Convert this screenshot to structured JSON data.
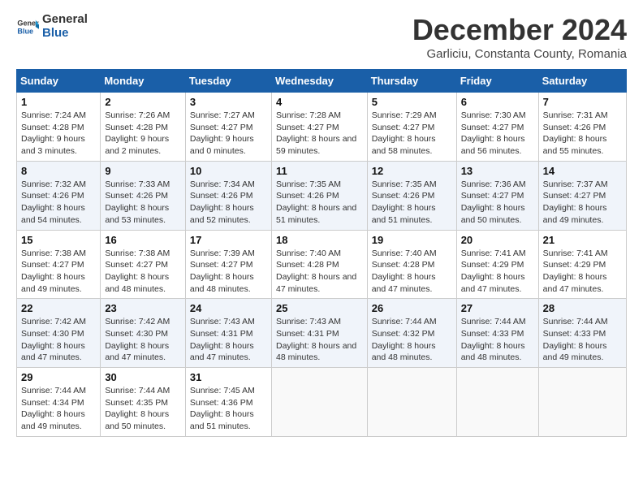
{
  "header": {
    "logo_line1": "General",
    "logo_line2": "Blue",
    "month_title": "December 2024",
    "subtitle": "Garliciu, Constanta County, Romania"
  },
  "days_of_week": [
    "Sunday",
    "Monday",
    "Tuesday",
    "Wednesday",
    "Thursday",
    "Friday",
    "Saturday"
  ],
  "weeks": [
    [
      {
        "num": "1",
        "rise": "7:24 AM",
        "set": "4:28 PM",
        "daylight": "9 hours and 3 minutes."
      },
      {
        "num": "2",
        "rise": "7:26 AM",
        "set": "4:28 PM",
        "daylight": "9 hours and 2 minutes."
      },
      {
        "num": "3",
        "rise": "7:27 AM",
        "set": "4:27 PM",
        "daylight": "9 hours and 0 minutes."
      },
      {
        "num": "4",
        "rise": "7:28 AM",
        "set": "4:27 PM",
        "daylight": "8 hours and 59 minutes."
      },
      {
        "num": "5",
        "rise": "7:29 AM",
        "set": "4:27 PM",
        "daylight": "8 hours and 58 minutes."
      },
      {
        "num": "6",
        "rise": "7:30 AM",
        "set": "4:27 PM",
        "daylight": "8 hours and 56 minutes."
      },
      {
        "num": "7",
        "rise": "7:31 AM",
        "set": "4:26 PM",
        "daylight": "8 hours and 55 minutes."
      }
    ],
    [
      {
        "num": "8",
        "rise": "7:32 AM",
        "set": "4:26 PM",
        "daylight": "8 hours and 54 minutes."
      },
      {
        "num": "9",
        "rise": "7:33 AM",
        "set": "4:26 PM",
        "daylight": "8 hours and 53 minutes."
      },
      {
        "num": "10",
        "rise": "7:34 AM",
        "set": "4:26 PM",
        "daylight": "8 hours and 52 minutes."
      },
      {
        "num": "11",
        "rise": "7:35 AM",
        "set": "4:26 PM",
        "daylight": "8 hours and 51 minutes."
      },
      {
        "num": "12",
        "rise": "7:35 AM",
        "set": "4:26 PM",
        "daylight": "8 hours and 51 minutes."
      },
      {
        "num": "13",
        "rise": "7:36 AM",
        "set": "4:27 PM",
        "daylight": "8 hours and 50 minutes."
      },
      {
        "num": "14",
        "rise": "7:37 AM",
        "set": "4:27 PM",
        "daylight": "8 hours and 49 minutes."
      }
    ],
    [
      {
        "num": "15",
        "rise": "7:38 AM",
        "set": "4:27 PM",
        "daylight": "8 hours and 49 minutes."
      },
      {
        "num": "16",
        "rise": "7:38 AM",
        "set": "4:27 PM",
        "daylight": "8 hours and 48 minutes."
      },
      {
        "num": "17",
        "rise": "7:39 AM",
        "set": "4:27 PM",
        "daylight": "8 hours and 48 minutes."
      },
      {
        "num": "18",
        "rise": "7:40 AM",
        "set": "4:28 PM",
        "daylight": "8 hours and 47 minutes."
      },
      {
        "num": "19",
        "rise": "7:40 AM",
        "set": "4:28 PM",
        "daylight": "8 hours and 47 minutes."
      },
      {
        "num": "20",
        "rise": "7:41 AM",
        "set": "4:29 PM",
        "daylight": "8 hours and 47 minutes."
      },
      {
        "num": "21",
        "rise": "7:41 AM",
        "set": "4:29 PM",
        "daylight": "8 hours and 47 minutes."
      }
    ],
    [
      {
        "num": "22",
        "rise": "7:42 AM",
        "set": "4:30 PM",
        "daylight": "8 hours and 47 minutes."
      },
      {
        "num": "23",
        "rise": "7:42 AM",
        "set": "4:30 PM",
        "daylight": "8 hours and 47 minutes."
      },
      {
        "num": "24",
        "rise": "7:43 AM",
        "set": "4:31 PM",
        "daylight": "8 hours and 47 minutes."
      },
      {
        "num": "25",
        "rise": "7:43 AM",
        "set": "4:31 PM",
        "daylight": "8 hours and 48 minutes."
      },
      {
        "num": "26",
        "rise": "7:44 AM",
        "set": "4:32 PM",
        "daylight": "8 hours and 48 minutes."
      },
      {
        "num": "27",
        "rise": "7:44 AM",
        "set": "4:33 PM",
        "daylight": "8 hours and 48 minutes."
      },
      {
        "num": "28",
        "rise": "7:44 AM",
        "set": "4:33 PM",
        "daylight": "8 hours and 49 minutes."
      }
    ],
    [
      {
        "num": "29",
        "rise": "7:44 AM",
        "set": "4:34 PM",
        "daylight": "8 hours and 49 minutes."
      },
      {
        "num": "30",
        "rise": "7:44 AM",
        "set": "4:35 PM",
        "daylight": "8 hours and 50 minutes."
      },
      {
        "num": "31",
        "rise": "7:45 AM",
        "set": "4:36 PM",
        "daylight": "8 hours and 51 minutes."
      },
      null,
      null,
      null,
      null
    ]
  ],
  "labels": {
    "sunrise": "Sunrise:",
    "sunset": "Sunset:",
    "daylight": "Daylight:"
  }
}
